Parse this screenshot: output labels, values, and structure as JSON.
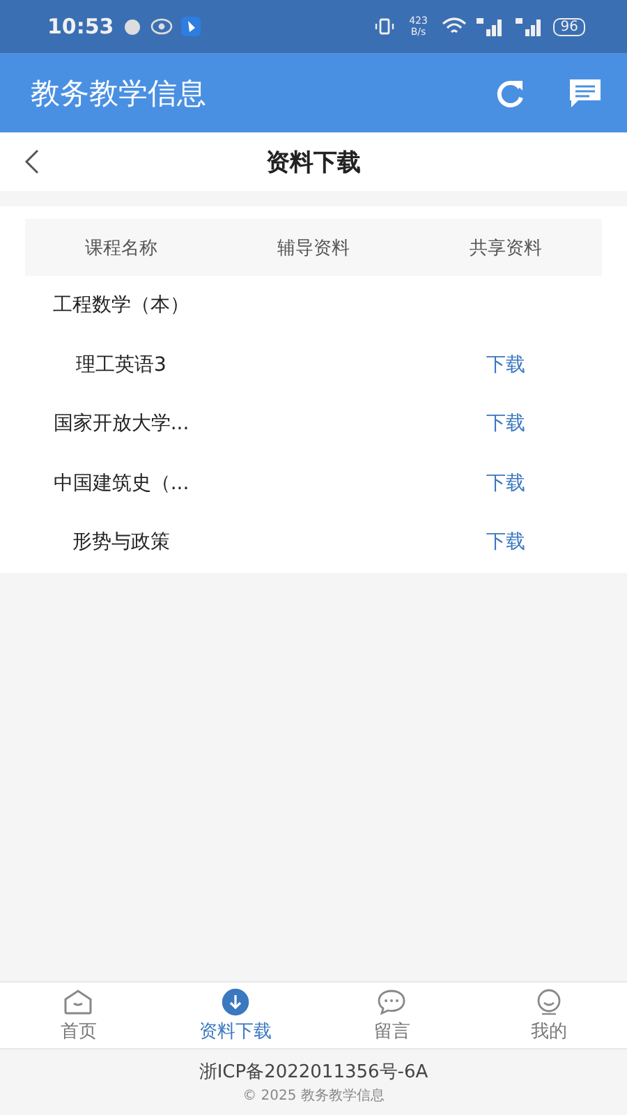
{
  "status_bar": {
    "time": "10:53",
    "network_speed": "423 B/s",
    "battery": "96"
  },
  "app_bar": {
    "title": "教务教学信息"
  },
  "page_header": {
    "title": "资料下载"
  },
  "table": {
    "columns": [
      "课程名称",
      "辅导资料",
      "共享资料"
    ],
    "rows": [
      {
        "course": "工程数学（本）"
      },
      {
        "course": "理工英语3",
        "shared": "下载"
      },
      {
        "course": "国家开放大学...",
        "shared": "下载"
      },
      {
        "course": "中国建筑史（...",
        "shared": "下载"
      },
      {
        "course": "形势与政策",
        "shared": "下载"
      }
    ]
  },
  "tabs": [
    {
      "label": "首页",
      "kind": "home",
      "selected": false
    },
    {
      "label": "资料下载",
      "kind": "download",
      "selected": true
    },
    {
      "label": "留言",
      "kind": "message",
      "selected": false
    },
    {
      "label": "我的",
      "kind": "profile",
      "selected": false
    }
  ],
  "footer": {
    "icp": "浙ICP备2022011356号-6A",
    "copyright": "© 2025 教务教学信息"
  }
}
